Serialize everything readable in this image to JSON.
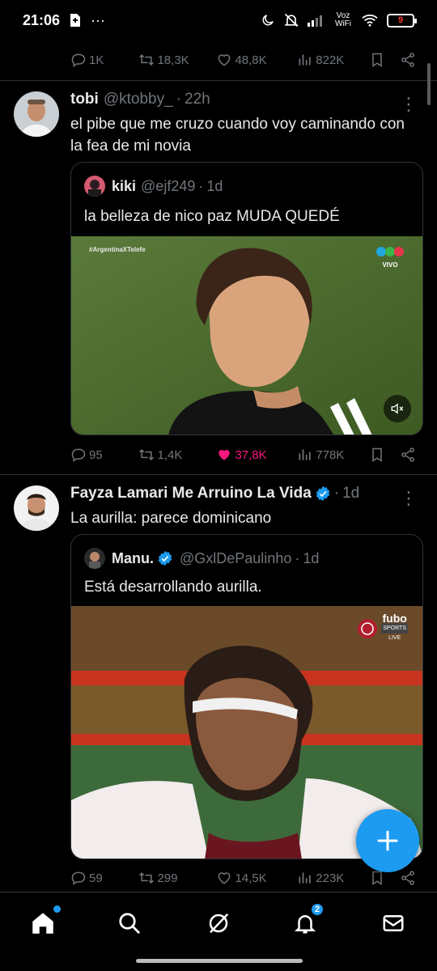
{
  "status_bar": {
    "time": "21:06",
    "network": "Voz WiFi",
    "battery": "9"
  },
  "top_actions": {
    "replies": "1K",
    "retweets": "18,3K",
    "likes": "48,8K",
    "views": "822K"
  },
  "tweet1": {
    "name": "tobi",
    "handle": "@ktobby_",
    "time": "22h",
    "text": "el pibe que me cruzo cuando voy caminando con la fea de mi novia",
    "quote": {
      "name": "kiki",
      "handle": "@ejf249",
      "time": "1d",
      "text": "la belleza de nico paz MUDA QUEDÉ",
      "media_hashtag": "#ArgentinaXTelefe",
      "media_live": "VIVO"
    },
    "actions": {
      "replies": "95",
      "retweets": "1,4K",
      "likes": "37,8K",
      "views": "778K",
      "liked": true
    }
  },
  "tweet2": {
    "name": "Fayza Lamari Me Arruino La Vida",
    "time": "1d",
    "text": "La aurilla: parece dominicano",
    "quote": {
      "name": "Manu.",
      "handle": "@GxlDePaulinho",
      "time": "1d",
      "text": "Está desarrollando aurilla.",
      "media_brand": "fubo",
      "media_brand_sub": "SPORTS",
      "media_live": "LIVE"
    },
    "actions": {
      "replies": "59",
      "retweets": "299",
      "likes": "14,5K",
      "views": "223K"
    }
  },
  "nav": {
    "notifications_badge": "2"
  },
  "colors": {
    "accent": "#1d9bf0",
    "like": "#f91880",
    "muted": "#71767b",
    "text": "#e7e9ea"
  }
}
